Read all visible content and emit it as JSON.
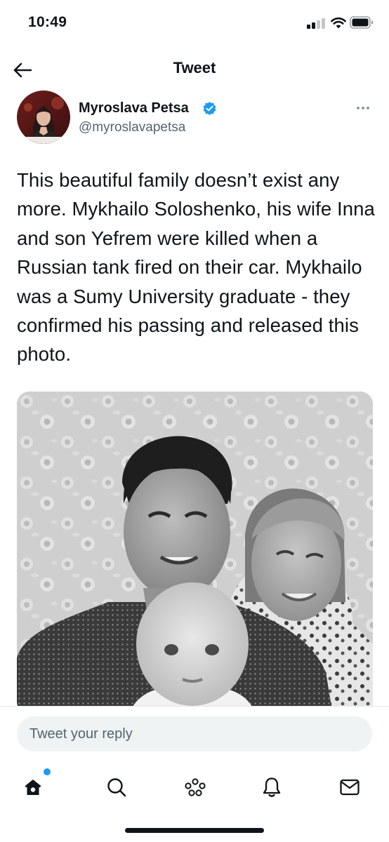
{
  "status_bar": {
    "time": "10:49",
    "icons": [
      "cellular-signal-icon",
      "wifi-icon",
      "battery-icon"
    ]
  },
  "header": {
    "title": "Tweet",
    "back_icon": "arrow-left-icon"
  },
  "tweet": {
    "author": {
      "name": "Myroslava Petsa",
      "handle": "@myroslavapetsa",
      "verified": true
    },
    "more_icon": "more-horizontal-icon",
    "text": "This beautiful family doesn’t exist any more. Mykhailo Soloshenko, his wife Inna and son Yefrem were killed when a Russian tank fired on their car. Mykhailo was a Sumy University graduate - they confirmed his passing and released this photo."
  },
  "reply": {
    "placeholder": "Tweet your reply"
  },
  "tab_bar": {
    "items": [
      {
        "icon": "home-icon",
        "active": true,
        "has_notification_dot": true
      },
      {
        "icon": "search-icon",
        "active": false
      },
      {
        "icon": "spaces-icon",
        "active": false
      },
      {
        "icon": "bell-icon",
        "active": false
      },
      {
        "icon": "mail-icon",
        "active": false
      }
    ]
  },
  "colors": {
    "accent": "#1d9bf0",
    "text_primary": "#0f1419",
    "text_secondary": "#536471",
    "reply_field_bg": "#eff3f4"
  }
}
